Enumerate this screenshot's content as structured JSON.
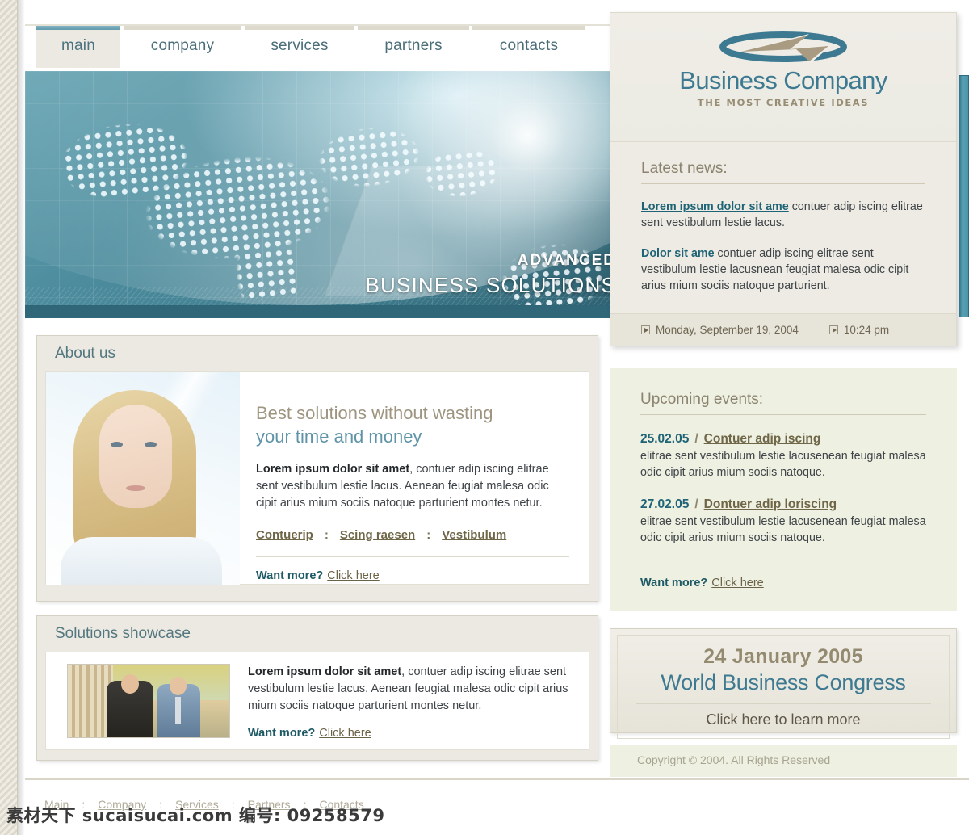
{
  "nav": {
    "tabs": [
      {
        "label": "main",
        "active": true
      },
      {
        "label": "company",
        "active": false
      },
      {
        "label": "services",
        "active": false
      },
      {
        "label": "partners",
        "active": false
      },
      {
        "label": "contacts",
        "active": false
      }
    ]
  },
  "hero": {
    "kicker": "ADVANCED",
    "title": "BUSINESS SOLUTIONS"
  },
  "about": {
    "panel_title": "About us",
    "heading_line1": "Best solutions without wasting",
    "heading_line2": "your time and money",
    "paragraph_bold": "Lorem ipsum dolor sit amet",
    "paragraph_rest": ", contuer adip iscing elitrae sent vestibulum lestie lacus. Aenean  feugiat malesa odic cipit arius mium sociis natoque parturient montes netur.",
    "links": [
      "Contuerip",
      "Scing raesen",
      "Vestibulum"
    ],
    "link_separator": ":",
    "want_more_label": "Want more?",
    "want_more_link": "Click here"
  },
  "solutions": {
    "panel_title": "Solutions showcase",
    "paragraph_bold": "Lorem ipsum dolor sit amet",
    "paragraph_rest": ", contuer adip iscing elitrae sent vestibulum lestie lacus. Aenean  feugiat malesa odic cipit arius mium sociis natoque parturient montes netur.",
    "want_more_label": "Want more?",
    "want_more_link": "Click here"
  },
  "logo": {
    "name": "Business Company",
    "tagline": "THE MOST CREATIVE IDEAS"
  },
  "news": {
    "heading": "Latest news:",
    "items": [
      {
        "link": "Lorem ipsum dolor sit ame",
        "text": " contuer adip iscing elitrae sent vestibulum lestie lacus."
      },
      {
        "link": "Dolor sit ame",
        "text": " contuer adip iscing elitrae sent vestibulum lestie lacusnean  feugiat malesa odic cipit arius mium sociis natoque parturient."
      }
    ],
    "date": "Monday, September 19, 2004",
    "time": "10:24 pm"
  },
  "events": {
    "heading": "Upcoming events:",
    "items": [
      {
        "date": "25.02.05",
        "separator": "/",
        "link": "Contuer adip iscing",
        "text": "elitrae sent vestibulum lestie lacusenean  feugiat malesa odic cipit arius mium sociis natoque."
      },
      {
        "date": "27.02.05",
        "separator": "/",
        "link": "Dontuer adip loriscing",
        "text": "elitrae sent vestibulum lestie lacusenean  feugiat malesa odic cipit arius mium sociis natoque."
      }
    ],
    "want_more_label": "Want more?",
    "want_more_link": "Click here"
  },
  "promo": {
    "date": "24 January 2005",
    "title": "World Business Congress",
    "link": "Click here to learn more"
  },
  "copyright": "Copyright © 2004. All Rights Reserved",
  "footer": {
    "links": [
      "Main",
      "Company",
      "Services",
      "Partners",
      "Contacts"
    ],
    "separator": ":"
  },
  "watermark": "素材天下 sucaisucai.com 编号: 09258579",
  "colors": {
    "teal": "#3d7a92",
    "accent_link": "#1f6476",
    "khaki": "#8b8370",
    "panel_bg": "#ebe9e2",
    "events_bg": "#eef0e1"
  }
}
